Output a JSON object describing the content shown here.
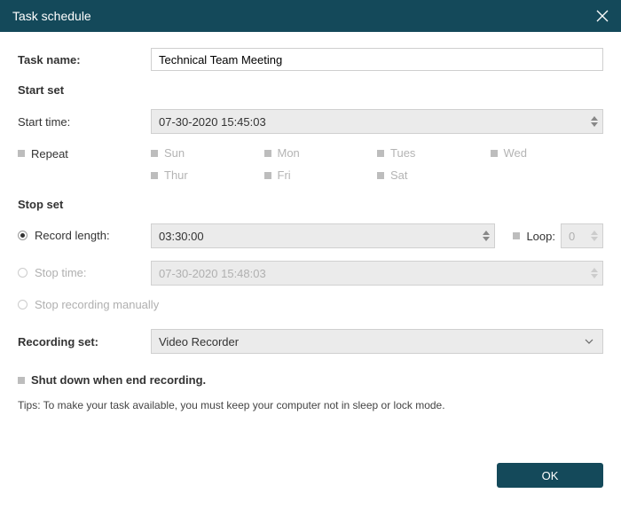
{
  "titlebar": {
    "title": "Task schedule"
  },
  "task_name": {
    "label": "Task name:",
    "value": "Technical Team Meeting"
  },
  "start_set": {
    "heading": "Start set",
    "start_time_label": "Start time:",
    "start_time_value": "07-30-2020 15:45:03",
    "repeat_label": "Repeat",
    "days": {
      "sun": "Sun",
      "mon": "Mon",
      "tues": "Tues",
      "wed": "Wed",
      "thur": "Thur",
      "fri": "Fri",
      "sat": "Sat"
    }
  },
  "stop_set": {
    "heading": "Stop set",
    "record_length_label": "Record length:",
    "record_length_value": "03:30:00",
    "loop_label": "Loop:",
    "loop_value": "0",
    "stop_time_label": "Stop time:",
    "stop_time_value": "07-30-2020 15:48:03",
    "stop_manual_label": "Stop recording manually"
  },
  "recording_set": {
    "label": "Recording set:",
    "value": "Video Recorder"
  },
  "shutdown": {
    "label": "Shut down when end recording."
  },
  "tips": "Tips: To make your task available, you must keep your computer not in sleep or lock mode.",
  "buttons": {
    "ok": "OK"
  }
}
